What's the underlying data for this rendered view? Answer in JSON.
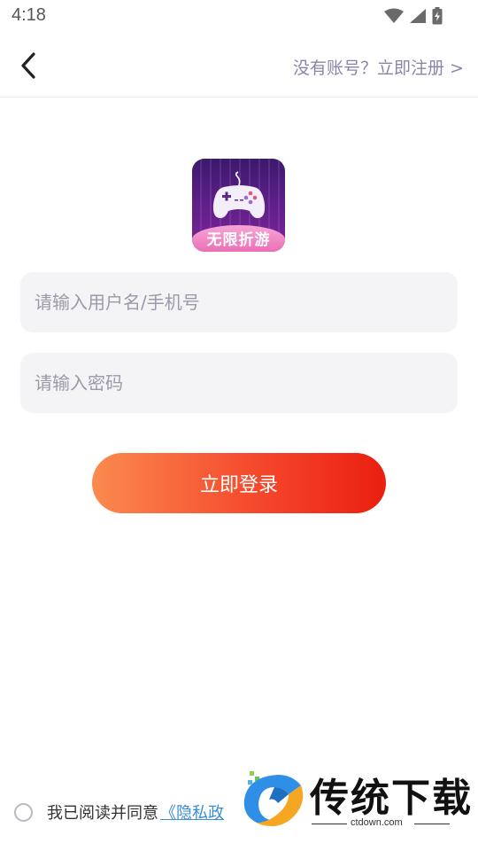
{
  "status_bar": {
    "time": "4:18",
    "icons": [
      "wifi-icon",
      "signal-icon",
      "battery-charging-icon"
    ]
  },
  "nav": {
    "back_icon": "chevron-left-icon",
    "register_link": "没有账号？立即注册 >"
  },
  "app_logo": {
    "text": "无限折游",
    "icon": "gamepad-icon"
  },
  "form": {
    "username_placeholder": "请输入用户名/手机号",
    "username_value": "",
    "password_placeholder": "请输入密码",
    "password_value": ""
  },
  "login_button": "立即登录",
  "agreement": {
    "checked": false,
    "text": "我已阅读并同意",
    "link": "《隐私政"
  },
  "watermark": {
    "title": "传统下载",
    "url": "ctdown.com"
  },
  "colors": {
    "register_link": "#8a85a8",
    "button_gradient_start": "#fb8a4e",
    "button_gradient_end": "#ea1f10",
    "field_background": "#f4f4f6",
    "link": "#3a8dd9"
  }
}
